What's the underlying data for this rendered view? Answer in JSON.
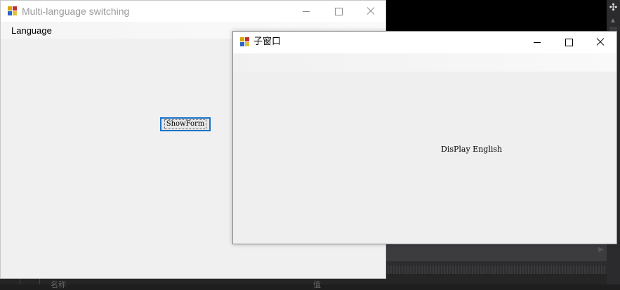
{
  "main_window": {
    "title": "Multi-language switching",
    "menu": {
      "language_label": "Language"
    },
    "showform_button_label": "ShowForm"
  },
  "child_window": {
    "title": "子窗口",
    "label_text": "DisPlay English"
  },
  "background": {
    "partial_text_left": "名称",
    "partial_text_right": "值"
  },
  "colors": {
    "main_title_text": "#9a9a9a",
    "child_title_text": "#000000",
    "button_focus_border": "#1a73c9",
    "form_background": "#f0f0f0"
  },
  "icons": {
    "app": "winforms-app-icon",
    "minimize": "minimize-icon",
    "maximize": "maximize-icon",
    "close": "close-icon",
    "scroll_grip": "split-grip-icon"
  }
}
